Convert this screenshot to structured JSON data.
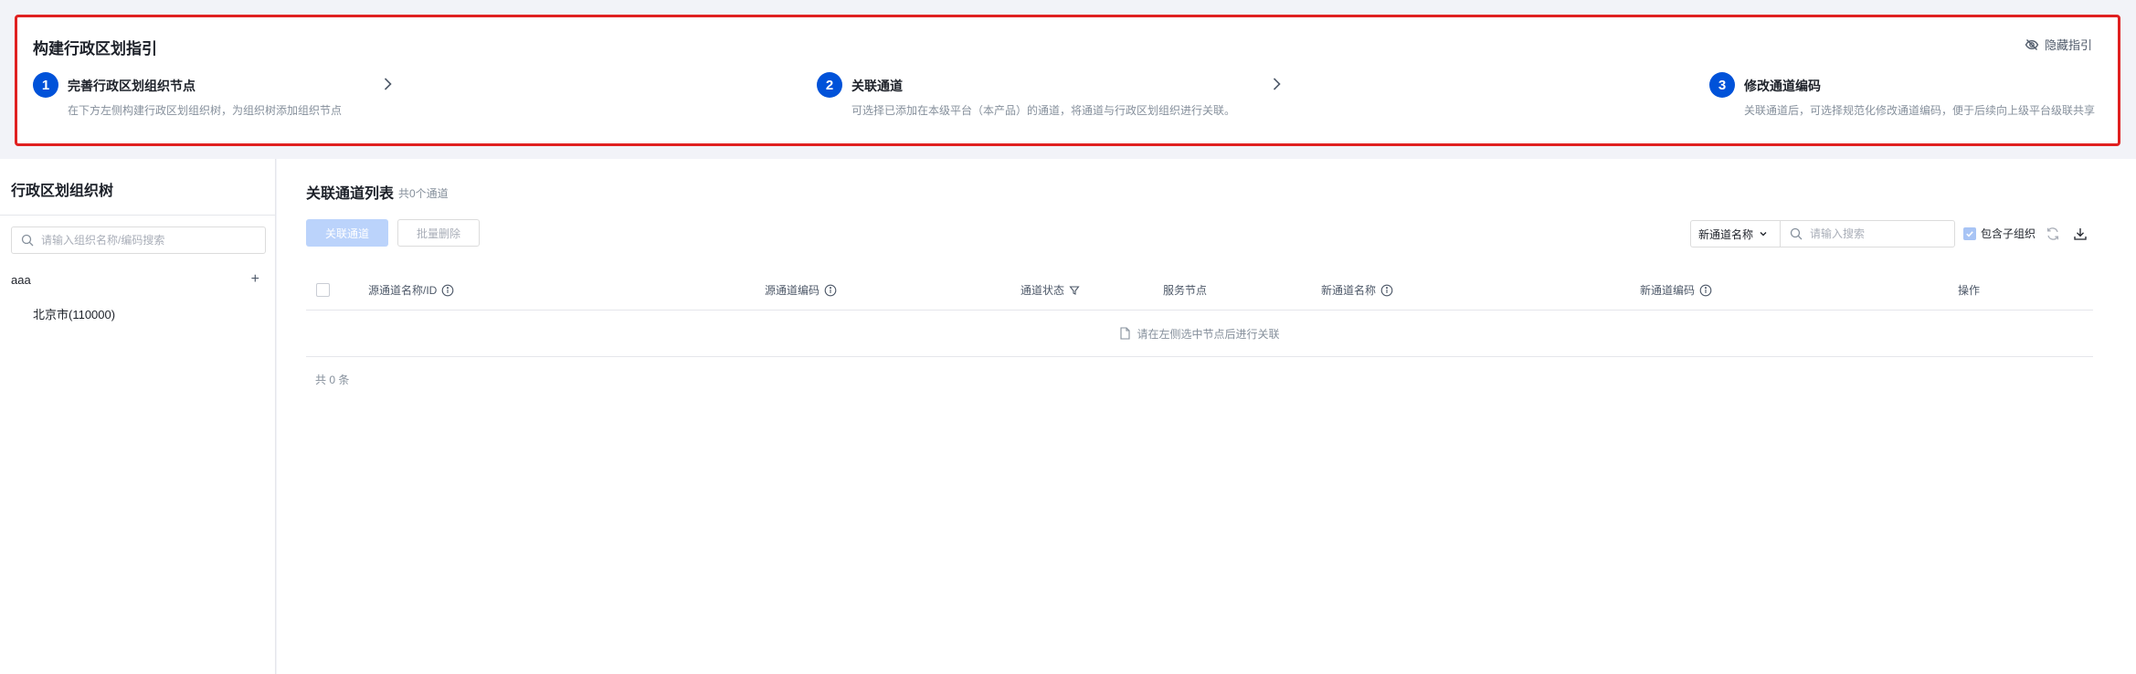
{
  "guide": {
    "title": "构建行政区划指引",
    "hide_label": "隐藏指引",
    "steps": [
      {
        "num": "1",
        "title": "完善行政区划组织节点",
        "desc": "在下方左侧构建行政区划组织树，为组织树添加组织节点"
      },
      {
        "num": "2",
        "title": "关联通道",
        "desc": "可选择已添加在本级平台（本产品）的通道，将通道与行政区划组织进行关联。"
      },
      {
        "num": "3",
        "title": "修改通道编码",
        "desc": "关联通道后，可选择规范化修改通道编码，便于后续向上级平台级联共享"
      }
    ]
  },
  "tree": {
    "title": "行政区划组织树",
    "search_placeholder": "请输入组织名称/编码搜索",
    "root_label": "aaa",
    "add_symbol": "+",
    "child_label": "北京市(110000)"
  },
  "list": {
    "title": "关联通道列表",
    "count": "共0个通道",
    "btn_link": "关联通道",
    "btn_batch_delete": "批量删除",
    "filter_field": "新通道名称",
    "search_placeholder": "请输入搜索",
    "include_sub": "包含子组织",
    "columns": [
      "源通道名称/ID",
      "源通道编码",
      "通道状态",
      "服务节点",
      "新通道名称",
      "新通道编码",
      "操作"
    ],
    "empty_text": "请在左侧选中节点后进行关联",
    "total": "共 0 条"
  },
  "colors": {
    "accent": "#0052d9",
    "highlight_border": "#e02020",
    "primary_disabled": "#bbd3fb"
  },
  "icons": [
    "eye-off-icon",
    "chevron-right-icon",
    "search-icon",
    "plus-icon",
    "chevron-down-icon",
    "refresh-icon",
    "download-icon",
    "info-icon",
    "filter-icon",
    "file-icon",
    "check-icon"
  ]
}
